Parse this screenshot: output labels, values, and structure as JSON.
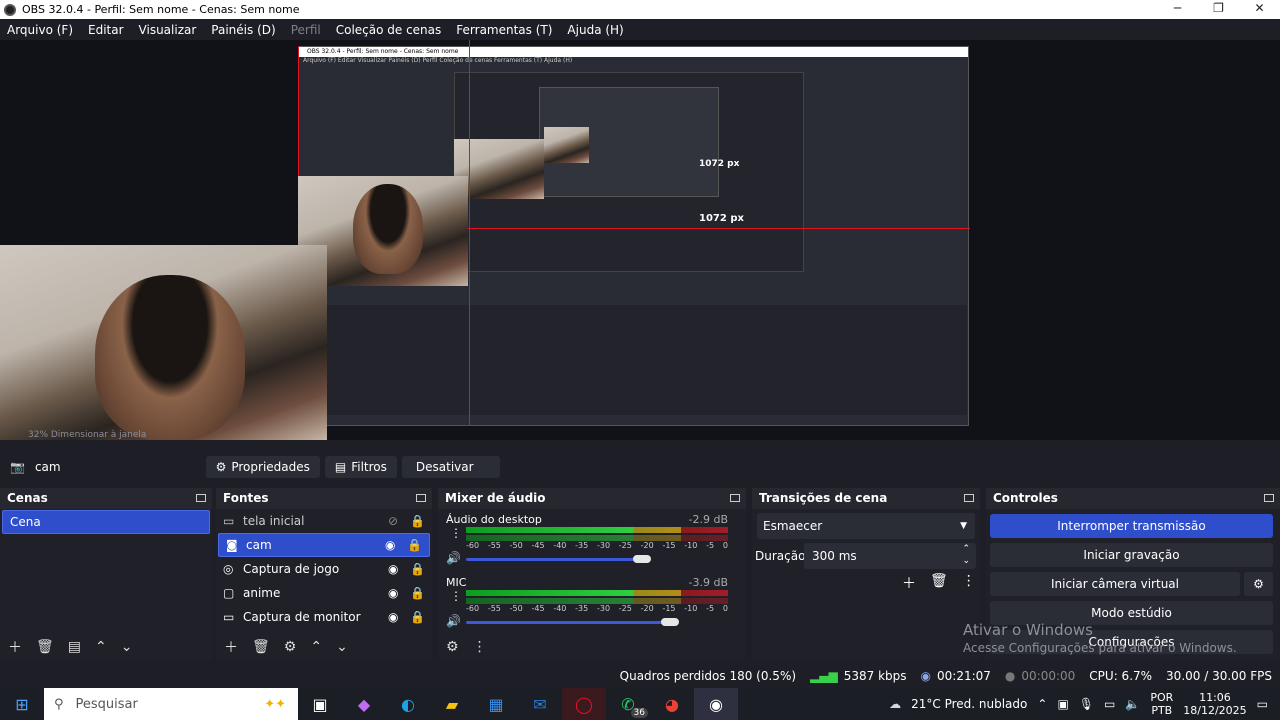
{
  "window": {
    "title": "OBS 32.0.4 - Perfil: Sem nome - Cenas: Sem nome",
    "min": "─",
    "max": "❐",
    "close": "✕"
  },
  "menu": [
    "Arquivo (F)",
    "Editar",
    "Visualizar",
    "Painéis (D)",
    "Perfil",
    "Coleção de cenas",
    "Ferramentas (T)",
    "Ajuda (H)"
  ],
  "preview": {
    "nested_title": "OBS 32.0.4 - Perfil: Sem nome - Cenas: Sem nome",
    "nested_menu": "Arquivo (F)   Editar   Visualizar   Painéis (D)   Perfil   Coleção de cenas   Ferramentas (T)   Ajuda (H)",
    "px_label_1": "1072 px",
    "px_label_2": "1072 px",
    "mini_status": "32%   Dimensionar à janela"
  },
  "source_bar": {
    "selected_source": "cam",
    "properties": "Propriedades",
    "filters": "Filtros",
    "deactivate": "Desativar"
  },
  "scenes": {
    "title": "Cenas",
    "items": [
      "Cena"
    ]
  },
  "sources": {
    "title": "Fontes",
    "items": [
      {
        "label": "tela inicial",
        "icon": "monitor-icon",
        "visible": false
      },
      {
        "label": "cam",
        "icon": "camera-icon",
        "visible": true
      },
      {
        "label": "Captura de jogo",
        "icon": "gamepad-icon",
        "visible": true
      },
      {
        "label": "anime",
        "icon": "window-icon",
        "visible": true
      },
      {
        "label": "Captura de monitor",
        "icon": "monitor-icon",
        "visible": true
      }
    ]
  },
  "mixer": {
    "title": "Mixer de áudio",
    "channels": [
      {
        "name": "Áudio do desktop",
        "db": "-2.9 dB",
        "level": 0.67
      },
      {
        "name": "MIC",
        "db": "-3.9 dB",
        "level": 0.78
      }
    ],
    "scale": [
      "-60",
      "-55",
      "-50",
      "-45",
      "-40",
      "-35",
      "-30",
      "-25",
      "-20",
      "-15",
      "-10",
      "-5",
      "0"
    ]
  },
  "transitions": {
    "title": "Transições de cena",
    "selected": "Esmaecer",
    "duration_label": "Duração",
    "duration_value": "300 ms"
  },
  "controls": {
    "title": "Controles",
    "stop_stream": "Interromper transmissão",
    "start_record": "Iniciar gravação",
    "virtual_cam": "Iniciar câmera virtual",
    "studio_mode": "Modo estúdio",
    "settings": "Configurações"
  },
  "watermark": {
    "line1": "Ativar o Windows",
    "line2": "Acesse Configurações para ativar o Windows."
  },
  "status": {
    "dropped": "Quadros perdidos 180 (0.5%)",
    "bitrate": "5387 kbps",
    "stream_time": "00:21:07",
    "rec_time": "00:00:00",
    "cpu": "CPU: 6.7%",
    "fps": "30.00 / 30.00 FPS"
  },
  "taskbar": {
    "search_placeholder": "Pesquisar",
    "weather": "21°C  Pred. nublado",
    "lang1": "POR",
    "lang2": "PTB",
    "time": "11:06",
    "date": "18/12/2025",
    "badge": "36"
  }
}
